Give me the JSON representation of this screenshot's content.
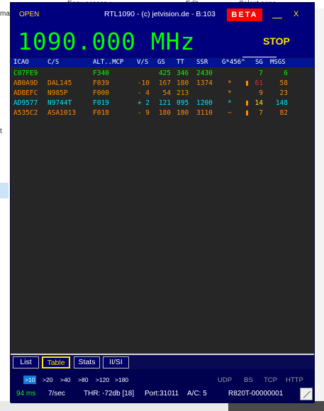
{
  "background": {
    "top_fragment_1": "Easy access ▾",
    "top_fragment_2": "Edit",
    "top_fragment_3": "Select none",
    "left_fragment": "mar",
    "left_fragment_2": "t"
  },
  "window": {
    "open_label": "OPEN",
    "title": "RTL1090 - (c) jetvision.de - B:103",
    "beta_label": "BETA",
    "minimize_label": "",
    "close_label": "X",
    "frequency": "1090.000 MHz",
    "stop_label": "STOP"
  },
  "table": {
    "headers": [
      "ICAO",
      "C/S",
      "ALT..MCP",
      "V/S",
      "GS",
      "TT",
      "SSR",
      "G*456^",
      "SG",
      "MSGS"
    ],
    "rows": [
      {
        "icao": "C07FE9",
        "cs": "",
        "alt": "F340",
        "vs": "",
        "gs": "425",
        "tt": "346",
        "ssr": "2430",
        "flag": "",
        "bar": false,
        "sg": "7",
        "msgs": "6",
        "color": "#00ff00",
        "sg_color": "#00ff00"
      },
      {
        "icao": "AB0A9D",
        "cs": "DAL145",
        "alt": "F039",
        "vs": "-10",
        "gs": "167",
        "tt": "180",
        "ssr": "1374",
        "flag": "*",
        "bar": true,
        "sg": "61",
        "msgs": "58",
        "color": "#ff8c00",
        "sg_color": "#ff2020"
      },
      {
        "icao": "ADBEFC",
        "cs": "N985P",
        "alt": "F000",
        "vs": "- 4",
        "gs": "54",
        "tt": "213",
        "ssr": "",
        "flag": "*",
        "bar": false,
        "sg": "9",
        "msgs": "23",
        "color": "#ff8c00",
        "sg_color": "#ff8c00"
      },
      {
        "icao": "AD9577",
        "cs": "N9744T",
        "alt": "F019",
        "vs": "+ 2",
        "gs": "121",
        "tt": "095",
        "ssr": "1200",
        "flag": "*",
        "bar": true,
        "sg": "14",
        "msgs": "148",
        "color": "#00e5ff",
        "sg_color": "#ffe600"
      },
      {
        "icao": "A535C2",
        "cs": "ASA1013",
        "alt": "F018",
        "vs": "- 9",
        "gs": "180",
        "tt": "180",
        "ssr": "3110",
        "flag": "~",
        "bar": true,
        "sg": "7",
        "msgs": "82",
        "color": "#ff8c00",
        "sg_color": "#ff8c00"
      }
    ]
  },
  "tabs": [
    {
      "label": "List",
      "active": false
    },
    {
      "label": "Table",
      "active": true
    },
    {
      "label": "Stats",
      "active": false
    },
    {
      "label": "II/SI",
      "active": false
    }
  ],
  "status": {
    "ranges": [
      ">10",
      ">20",
      ">40",
      ">80",
      ">120",
      ">180"
    ],
    "selected_range": ">10",
    "protocols": [
      "UDP",
      "BS",
      "TCP",
      "HTTP"
    ],
    "latency": "94 ms",
    "rate": "7/sec",
    "threshold": "THR: -72db [18]",
    "port": "Port:31011",
    "aircraft_count": "A/C: 5",
    "device": "R820T-00000001"
  },
  "colors": {
    "window_bg": "#0a0a54",
    "titlebar_bg": "#00007f",
    "header_bg": "#001493",
    "list_bg": "#262626",
    "frequency": "#00ff00",
    "accent_yellow": "#ffe600",
    "beta_red": "#ff0000"
  }
}
